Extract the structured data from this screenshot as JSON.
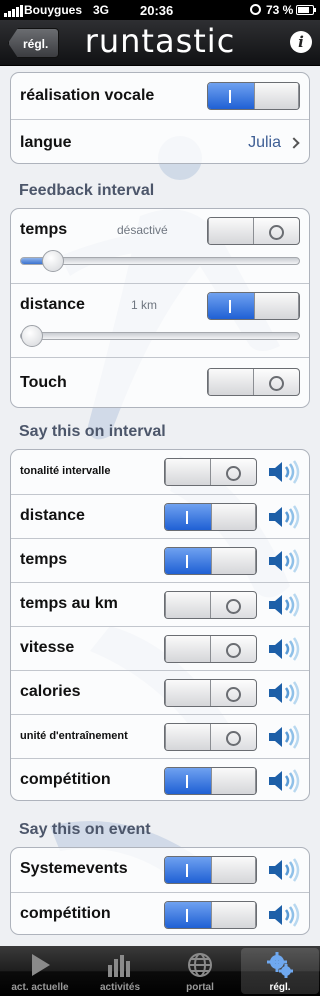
{
  "status_bar": {
    "carrier": "Bouygues",
    "network": "3G",
    "time": "20:36",
    "battery_percent": "73 %",
    "battery_level": 0.73
  },
  "nav": {
    "back_label": "régl.",
    "app_title": "runtastic",
    "info_icon": "info-icon"
  },
  "voice_group": {
    "voice_label": "réalisation vocale",
    "voice_on": true,
    "language_label": "langue",
    "language_value": "Julia"
  },
  "feedback_interval": {
    "header": "Feedback interval",
    "time_label": "temps",
    "time_value": "désactivé",
    "time_on": false,
    "time_slider": 0.06,
    "distance_label": "distance",
    "distance_value": "1 km",
    "distance_on": true,
    "distance_slider": 0.0,
    "touch_label": "Touch",
    "touch_on": false
  },
  "say_on_interval": {
    "header": "Say this on interval",
    "items": [
      {
        "label": "tonalité intervalle",
        "on": false
      },
      {
        "label": "distance",
        "on": true
      },
      {
        "label": "temps",
        "on": true
      },
      {
        "label": "temps au km",
        "on": false
      },
      {
        "label": "vitesse",
        "on": false
      },
      {
        "label": "calories",
        "on": false
      },
      {
        "label": "unité d'entraînement",
        "on": false
      },
      {
        "label": "compétition",
        "on": true
      }
    ]
  },
  "say_on_event": {
    "header": "Say this on event",
    "items": [
      {
        "label": "Systemevents",
        "on": true
      },
      {
        "label": "compétition",
        "on": true
      }
    ]
  },
  "tabs": [
    {
      "label": "act. actuelle",
      "icon": "play-icon",
      "active": false
    },
    {
      "label": "activités",
      "icon": "bar-chart-icon",
      "active": false
    },
    {
      "label": "portal",
      "icon": "globe-icon",
      "active": false
    },
    {
      "label": "régl.",
      "icon": "gears-icon",
      "active": true
    }
  ],
  "colors": {
    "accent_blue": "#1f60d4",
    "value_blue": "#3f5f95",
    "header_gray": "#4c566a",
    "speaker_blue": "#1d5fa8"
  }
}
